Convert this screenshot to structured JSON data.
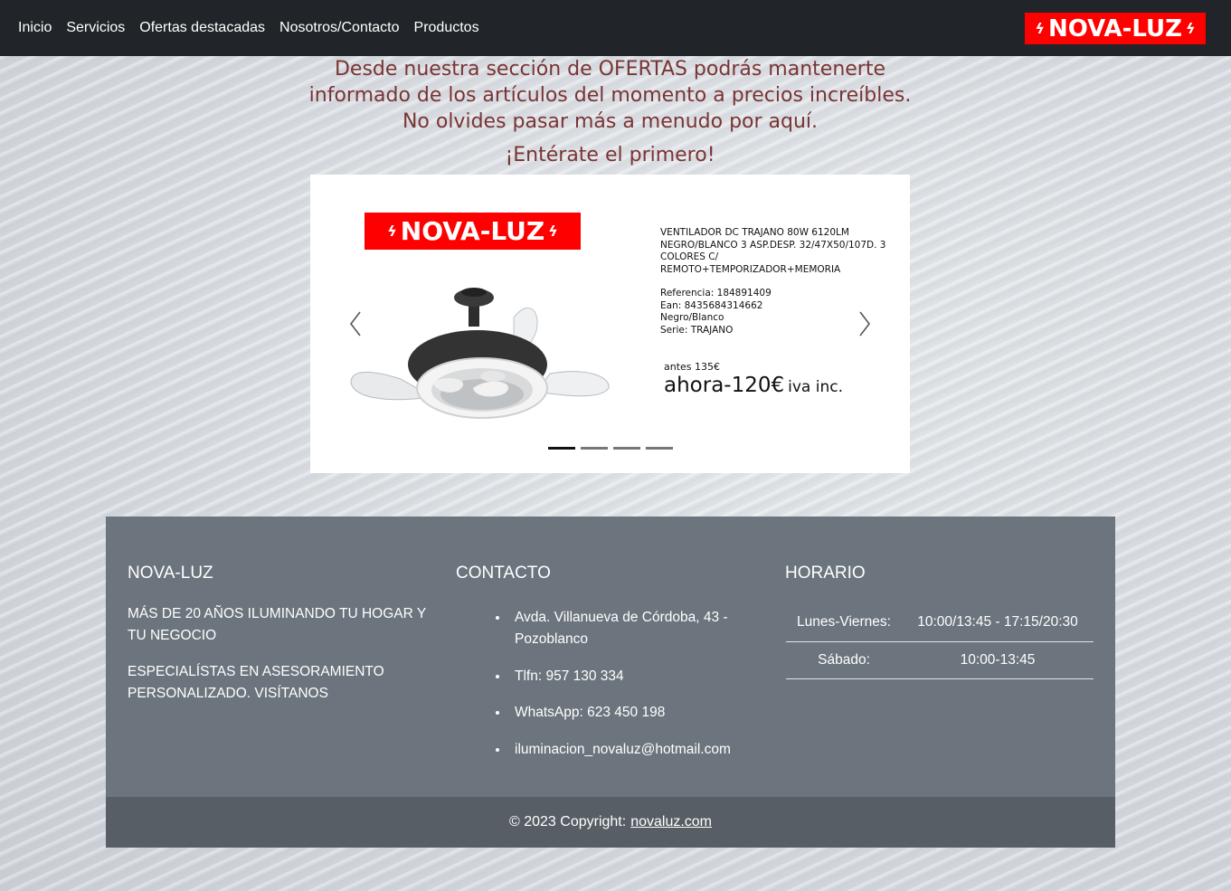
{
  "nav": {
    "links": [
      "Inicio",
      "Servicios",
      "Ofertas destacadas",
      "Nosotros/Contacto",
      "Productos"
    ],
    "brand": "NOVA-LUZ",
    "brand_color": "#ff0000"
  },
  "intro": {
    "line1": "Desde nuestra sección de OFERTAS podrás mantenerte",
    "line2": "informado de los artículos del momento a precios increíbles.",
    "line3": "No olvides pasar más a menudo por aquí.",
    "cta": "¡Entérate el primero!",
    "text_color": "#7a3434"
  },
  "carousel": {
    "logo": "NOVA-LUZ",
    "product_title": "VENTILADOR DC TRAJANO 80W 6120LM NEGRO/BLANCO 3 ASP.DESP. 32/47X50/107D. 3 COLORES C/ REMOTO+TEMPORIZADOR+MEMORIA",
    "specs": [
      "Referencia: 184891409",
      "Ean: 8435684314662",
      "Negro/Blanco",
      "Serie: TRAJANO"
    ],
    "price_before": "antes 135€",
    "price_now": "ahora-120€",
    "price_suffix": "iva inc.",
    "slides_count": 4,
    "active_slide": 1,
    "prev_icon": "chevron-left-icon",
    "next_icon": "chevron-right-icon"
  },
  "footer": {
    "col1_title": "NOVA-LUZ",
    "about": [
      "MÁS DE 20 AÑOS ILUMINANDO TU HOGAR Y TU NEGOCIO",
      "ESPECIALÍSTAS EN ASESORAMIENTO PERSONALIZADO. VISÍTANOS"
    ],
    "col2_title": "CONTACTO",
    "contact": [
      "Avda. Villanueva de Córdoba, 43 - Pozoblanco",
      "Tlfn: 957 130 334",
      "WhatsApp: 623 450 198",
      "iluminacion_novaluz@hotmail.com"
    ],
    "col3_title": "HORARIO",
    "hours": [
      {
        "day": "Lunes-Viernes:",
        "time": "10:00/13:45 - 17:15/20:30"
      },
      {
        "day": "Sábado:",
        "time": "10:00-13:45"
      }
    ],
    "copyright": "© 2023 Copyright:",
    "copyright_link": "novaluz.com",
    "bg_color": "#6c757d",
    "bar_color": "#575e65"
  }
}
